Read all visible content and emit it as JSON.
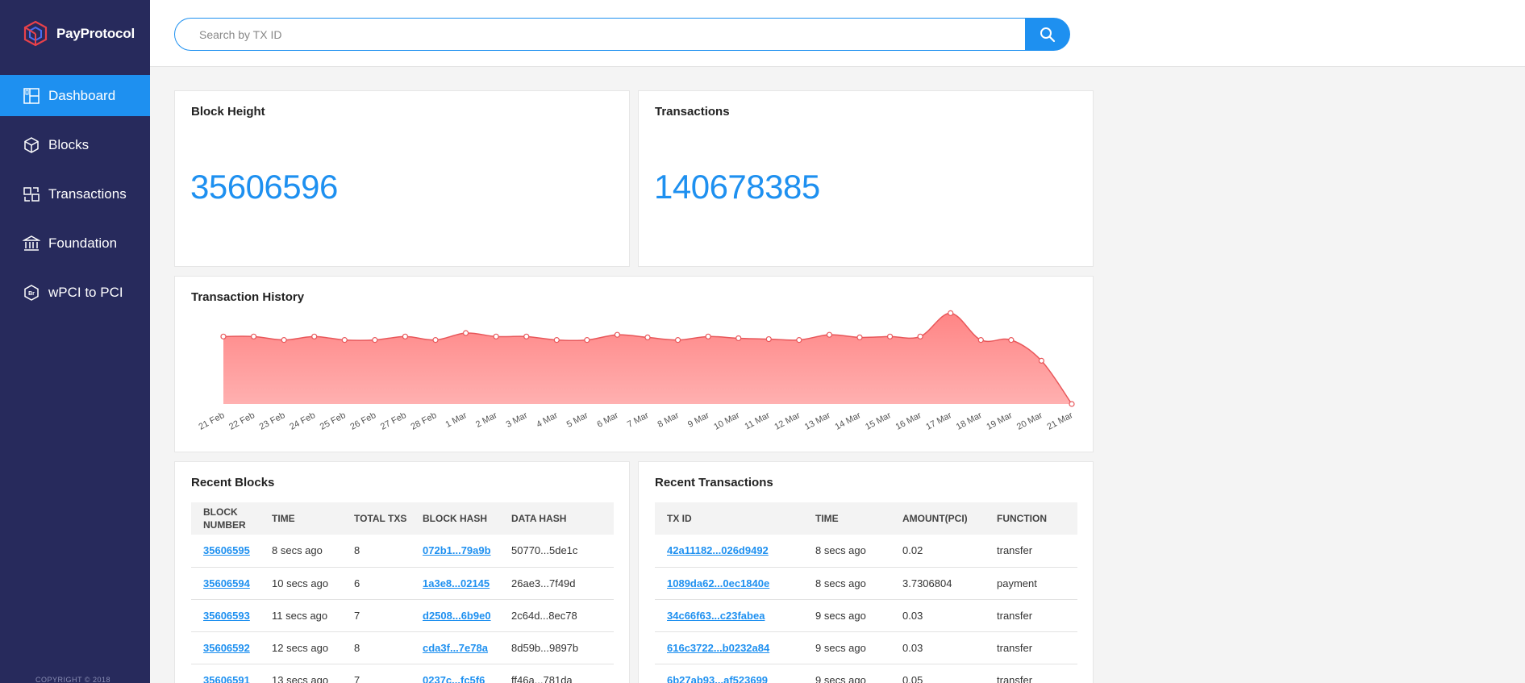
{
  "brand": {
    "name": "PayProtocol"
  },
  "sidebar": {
    "items": [
      {
        "label": "Dashboard",
        "icon": "dashboard-icon",
        "active": true
      },
      {
        "label": "Blocks",
        "icon": "cube-icon",
        "active": false
      },
      {
        "label": "Transactions",
        "icon": "transactions-icon",
        "active": false
      },
      {
        "label": "Foundation",
        "icon": "bank-icon",
        "active": false
      },
      {
        "label": "wPCI to PCI",
        "icon": "bridge-icon",
        "active": false
      }
    ],
    "copyright": "COPYRIGHT © 2018"
  },
  "search": {
    "placeholder": "Search by TX ID",
    "value": "",
    "icon": "search-icon"
  },
  "stats": {
    "block_height": {
      "title": "Block Height",
      "value": "35606596"
    },
    "transactions": {
      "title": "Transactions",
      "value": "140678385"
    }
  },
  "history": {
    "title": "Transaction History"
  },
  "chart_data": {
    "type": "area",
    "title": "Transaction History",
    "xlabel": "",
    "ylabel": "",
    "x": [
      "21 Feb",
      "22 Feb",
      "23 Feb",
      "24 Feb",
      "25 Feb",
      "26 Feb",
      "27 Feb",
      "28 Feb",
      "1 Mar",
      "2 Mar",
      "3 Mar",
      "4 Mar",
      "5 Mar",
      "6 Mar",
      "7 Mar",
      "8 Mar",
      "9 Mar",
      "10 Mar",
      "11 Mar",
      "12 Mar",
      "13 Mar",
      "14 Mar",
      "15 Mar",
      "16 Mar",
      "17 Mar",
      "18 Mar",
      "19 Mar",
      "20 Mar",
      "21 Mar"
    ],
    "series": [
      {
        "values": [
          78,
          78,
          74,
          78,
          74,
          74,
          78,
          74,
          82,
          78,
          78,
          74,
          74,
          80,
          77,
          74,
          78,
          76,
          75,
          74,
          80,
          77,
          78,
          78,
          105,
          74,
          74,
          50,
          0
        ]
      }
    ],
    "ylim": [
      0,
      110
    ],
    "grid": false,
    "colors": {
      "fill_top": "#ff8585",
      "fill_bottom": "#ffb0b0",
      "line": "#e8575a",
      "point_fill": "#ffffff"
    }
  },
  "recent_blocks": {
    "title": "Recent Blocks",
    "headers": [
      "BLOCK NUMBER",
      "TIME",
      "TOTAL TXS",
      "BLOCK HASH",
      "DATA HASH"
    ],
    "rows": [
      [
        "35606595",
        "8 secs ago",
        "8",
        "072b1...79a9b",
        "50770...5de1c"
      ],
      [
        "35606594",
        "10 secs ago",
        "6",
        "1a3e8...02145",
        "26ae3...7f49d"
      ],
      [
        "35606593",
        "11 secs ago",
        "7",
        "d2508...6b9e0",
        "2c64d...8ec78"
      ],
      [
        "35606592",
        "12 secs ago",
        "8",
        "cda3f...7e78a",
        "8d59b...9897b"
      ],
      [
        "35606591",
        "13 secs ago",
        "7",
        "0237c...fc5f6",
        "ff46a...781da"
      ]
    ]
  },
  "recent_transactions": {
    "title": "Recent Transactions",
    "headers": [
      "TX ID",
      "TIME",
      "AMOUNT(PCI)",
      "FUNCTION"
    ],
    "rows": [
      [
        "42a11182...026d9492",
        "8 secs ago",
        "0.02",
        "transfer"
      ],
      [
        "1089da62...0ec1840e",
        "8 secs ago",
        "3.7306804",
        "payment"
      ],
      [
        "34c66f63...c23fabea",
        "9 secs ago",
        "0.03",
        "transfer"
      ],
      [
        "616c3722...b0232a84",
        "9 secs ago",
        "0.03",
        "transfer"
      ],
      [
        "6b27ab93...af523699",
        "9 secs ago",
        "0.05",
        "transfer"
      ]
    ]
  },
  "colors": {
    "accent": "#1e90f0",
    "sidebar_bg": "#272a5c",
    "page_bg": "#f4f4f4"
  }
}
